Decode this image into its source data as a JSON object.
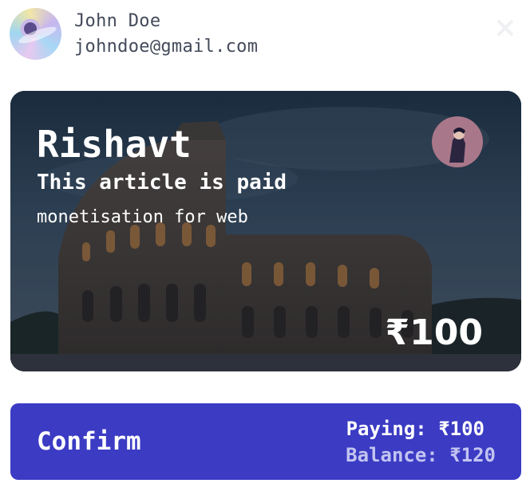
{
  "user": {
    "name": "John Doe",
    "email": "johndoe@gmail.com"
  },
  "article": {
    "author": "Rishavt",
    "status": "This article is paid",
    "description": "monetisation for web",
    "price": "₹100"
  },
  "confirm": {
    "label": "Confirm",
    "paying": "Paying: ₹100",
    "balance": "Balance: ₹120"
  },
  "colors": {
    "confirm_bg": "#3b3bc4",
    "balance_text": "#c2c4f0"
  },
  "icons": {
    "close": "close-icon"
  }
}
